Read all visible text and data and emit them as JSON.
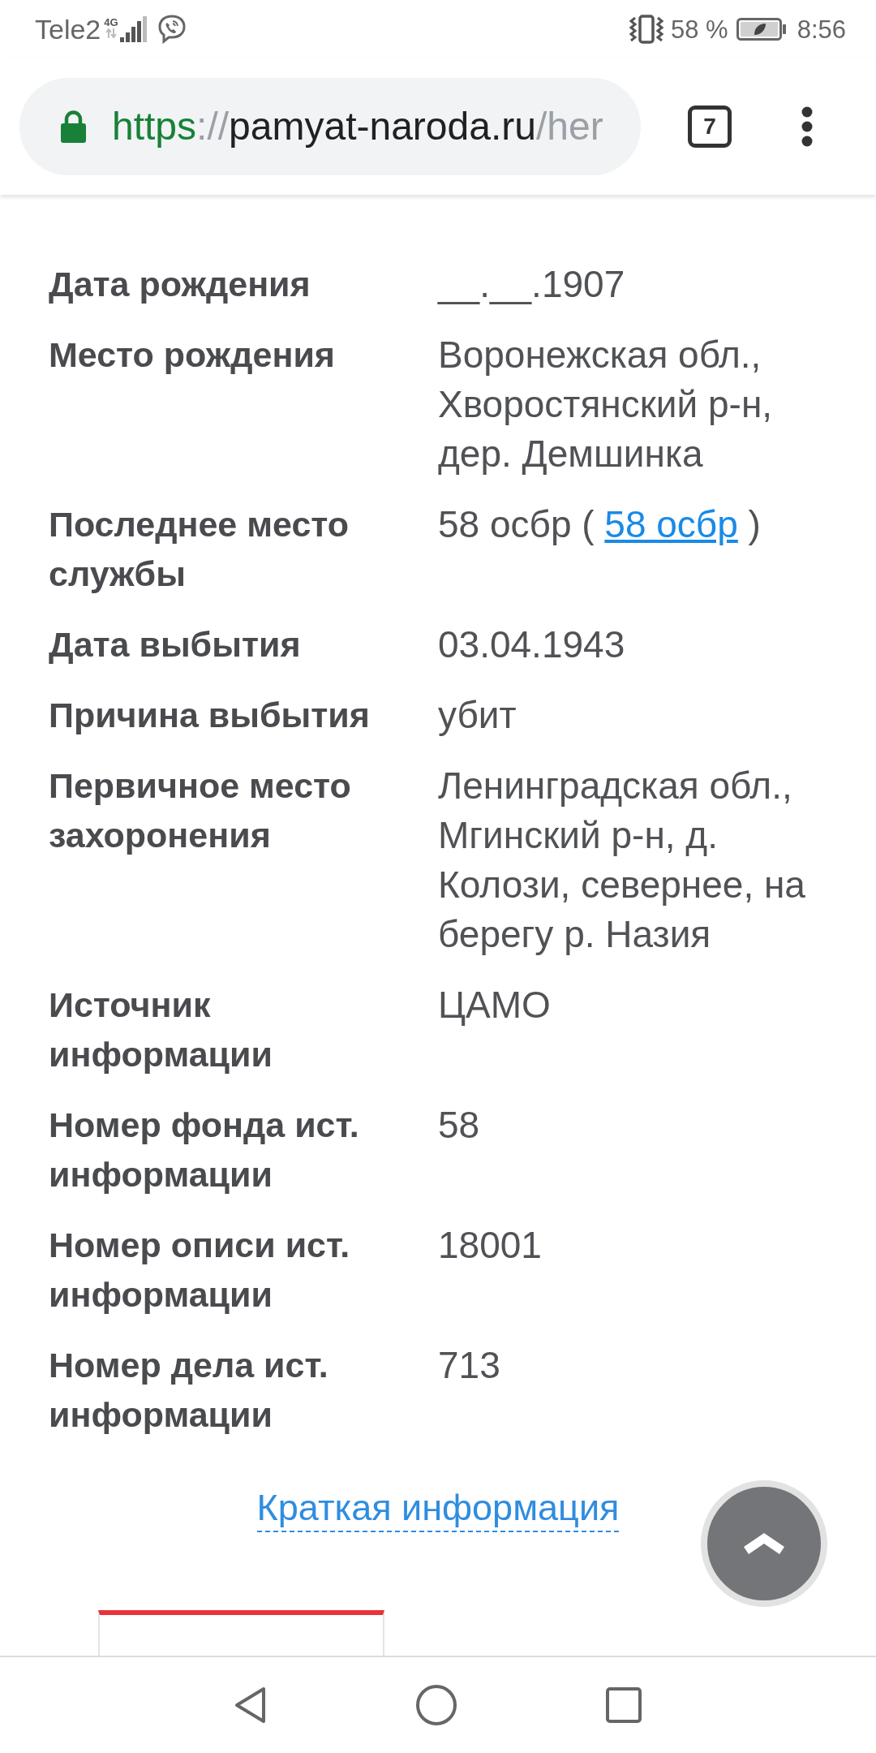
{
  "status_bar": {
    "carrier": "Tele2",
    "network": "4G",
    "battery": "58 %",
    "time": "8:56"
  },
  "browser_toolbar": {
    "url": [
      {
        "text": "https",
        "kind": "scheme"
      },
      {
        "text": "://",
        "kind": "separator"
      },
      {
        "text": "pamyat-naroda.ru",
        "kind": "host"
      },
      {
        "text": "/her",
        "kind": "path"
      }
    ],
    "tab_count": "7"
  },
  "details": [
    {
      "label": "Дата рождения",
      "value": "__.__.1907"
    },
    {
      "label": "Место рождения",
      "value": "Воронежская обл., Хворостянский р-н, дер. Демшинка"
    },
    {
      "label": "Последнее место службы",
      "value": "58 осбр ( ",
      "link": "58 осбр",
      "value_end": " )"
    },
    {
      "label": "Дата выбытия",
      "value": "03.04.1943"
    },
    {
      "label": "Причина выбытия",
      "value": "убит"
    },
    {
      "label": "Первичное место захоронения",
      "value": "Ленинградская обл., Мгинский р-н, д. Колози, севернее, на берегу р. Назия"
    },
    {
      "label": "Источник информации",
      "value": "ЦАМО"
    },
    {
      "label": "Номер фонда ист. информации",
      "value": "58"
    },
    {
      "label": "Номер описи ист. информации",
      "value": "18001"
    },
    {
      "label": "Номер дела ист. информации",
      "value": "713"
    }
  ],
  "summary_link": "Краткая информация"
}
